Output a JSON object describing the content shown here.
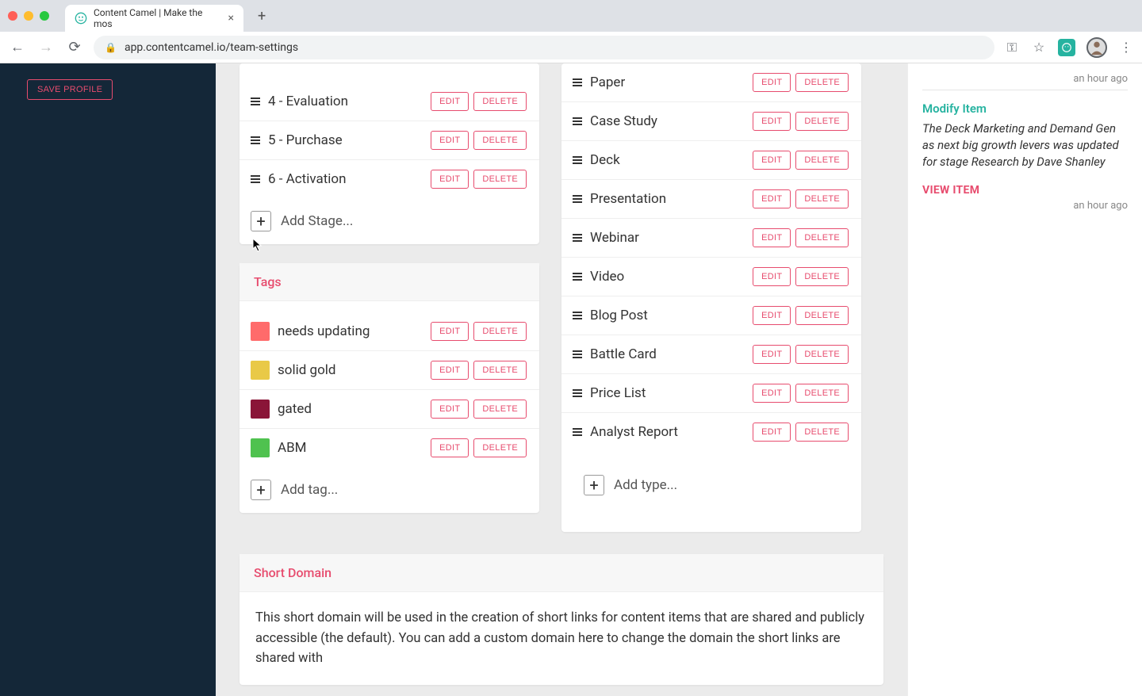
{
  "browser": {
    "tab_title": "Content Camel | Make the mos",
    "url": "app.contentcamel.io/team-settings"
  },
  "sidebar": {
    "save_profile": "SAVE PROFILE"
  },
  "labels": {
    "edit": "EDIT",
    "delete": "DELETE"
  },
  "stages": {
    "items": [
      {
        "label": "4 - Evaluation"
      },
      {
        "label": "5 - Purchase"
      },
      {
        "label": "6 - Activation"
      }
    ],
    "add": "Add Stage..."
  },
  "tags": {
    "title": "Tags",
    "items": [
      {
        "label": "needs updating",
        "color": "#ff6b6b"
      },
      {
        "label": "solid gold",
        "color": "#e9c947"
      },
      {
        "label": "gated",
        "color": "#8a1538"
      },
      {
        "label": "ABM",
        "color": "#4fc24f"
      }
    ],
    "add": "Add tag..."
  },
  "types": {
    "items": [
      {
        "label": "Paper"
      },
      {
        "label": "Case Study"
      },
      {
        "label": "Deck"
      },
      {
        "label": "Presentation"
      },
      {
        "label": "Webinar"
      },
      {
        "label": "Video"
      },
      {
        "label": "Blog Post"
      },
      {
        "label": "Battle Card"
      },
      {
        "label": "Price List"
      },
      {
        "label": "Analyst Report"
      }
    ],
    "add": "Add type..."
  },
  "short_domain": {
    "title": "Short Domain",
    "body": "This short domain will be used in the creation of short links for content items that are shared and publicly accessible (the default). You can add a custom domain here to change the domain the short links are shared with"
  },
  "activity": {
    "time1": "an hour ago",
    "title": "Modify Item",
    "body": "The Deck Marketing and Demand Gen as next big growth levers was updated for stage Research by Dave Shanley",
    "link": "VIEW ITEM",
    "time2": "an hour ago"
  }
}
